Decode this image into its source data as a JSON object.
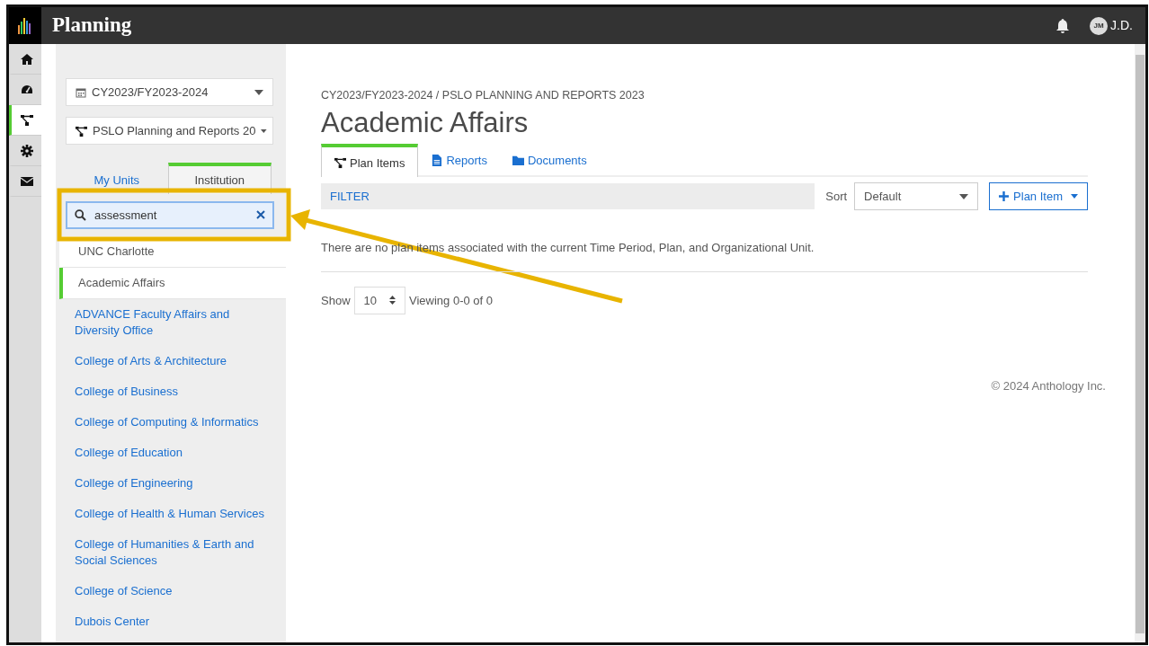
{
  "app": {
    "title": "Planning",
    "user_initials": "JM",
    "user_name": "J.D."
  },
  "rail": [
    {
      "kind": "home",
      "selected": false
    },
    {
      "kind": "gauge",
      "selected": false
    },
    {
      "kind": "tree",
      "selected": true
    },
    {
      "kind": "gear",
      "selected": false
    },
    {
      "kind": "mail",
      "selected": false
    }
  ],
  "sidebar": {
    "time_period": "CY2023/FY2023-2024",
    "plan": "PSLO Planning and Reports 20",
    "tabs": [
      {
        "label": "My Units",
        "selected": false
      },
      {
        "label": "Institution",
        "selected": true
      }
    ],
    "search": {
      "value": "assessment"
    },
    "units": [
      {
        "label": "UNC Charlotte",
        "kind": "ancestor",
        "selected": false
      },
      {
        "label": "Academic Affairs",
        "kind": "ancestor",
        "selected": true
      },
      {
        "label": "ADVANCE Faculty Affairs and Diversity Office",
        "kind": "child",
        "selected": false
      },
      {
        "label": "College of Arts & Architecture",
        "kind": "child",
        "selected": false
      },
      {
        "label": "College of Business",
        "kind": "child",
        "selected": false
      },
      {
        "label": "College of Computing & Informatics",
        "kind": "child",
        "selected": false
      },
      {
        "label": "College of Education",
        "kind": "child",
        "selected": false
      },
      {
        "label": "College of Engineering",
        "kind": "child",
        "selected": false
      },
      {
        "label": "College of Health & Human Services",
        "kind": "child",
        "selected": false
      },
      {
        "label": "College of Humanities & Earth and Social Sciences",
        "kind": "child",
        "selected": false
      },
      {
        "label": "College of Science",
        "kind": "child",
        "selected": false
      },
      {
        "label": "Dubois Center",
        "kind": "child",
        "selected": false
      }
    ]
  },
  "main": {
    "breadcrumb": "CY2023/FY2023-2024 / PSLO PLANNING AND REPORTS 2023",
    "title": "Academic Affairs",
    "tabs": [
      {
        "label": "Plan Items",
        "kind": "tree",
        "selected": true
      },
      {
        "label": "Reports",
        "kind": "file",
        "selected": false
      },
      {
        "label": "Documents",
        "kind": "folder",
        "selected": false
      }
    ],
    "filter": "FILTER",
    "sort_label": "Sort",
    "sort_value": "Default",
    "add_button": "Plan Item",
    "message": "There are no plan items associated with the current Time Period, Plan, and Organizational Unit.",
    "show_label": "Show",
    "page_size": "10",
    "viewing": "Viewing 0-0 of 0",
    "footer": "© 2024 Anthology Inc."
  },
  "annotations": {
    "highlight_box": true,
    "arrow": true
  }
}
